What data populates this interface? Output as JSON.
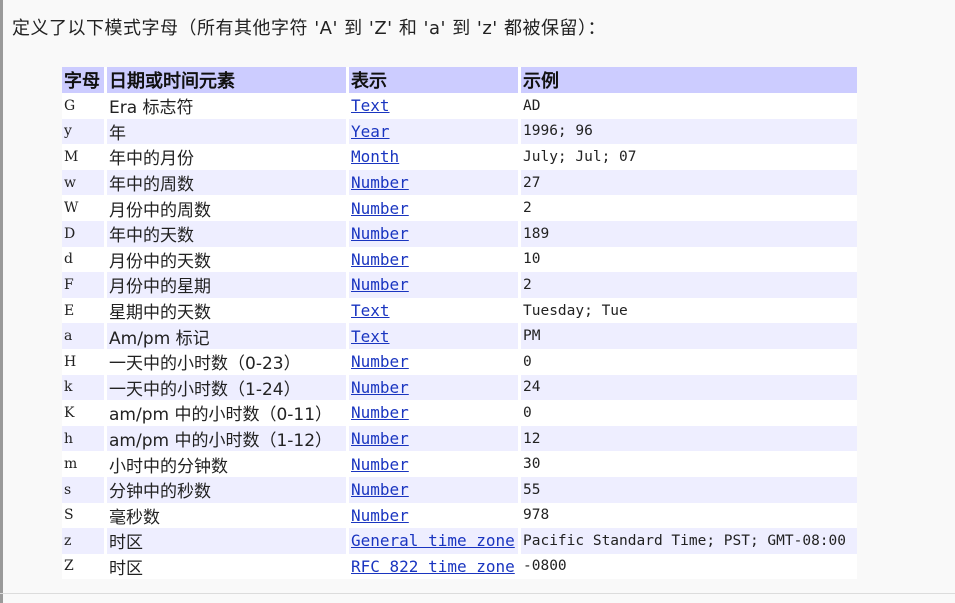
{
  "intro": "定义了以下模式字母（所有其他字符 'A' 到 'Z' 和 'a' 到 'z' 都被保留）：",
  "table": {
    "headers": [
      "字母",
      "日期或时间元素",
      "表示",
      "示例"
    ],
    "rows": [
      {
        "letter": "G",
        "element": "Era 标志符",
        "presentation": "Text",
        "example": "AD"
      },
      {
        "letter": "y",
        "element": "年",
        "presentation": "Year",
        "example": "1996; 96"
      },
      {
        "letter": "M",
        "element": "年中的月份",
        "presentation": "Month",
        "example": "July; Jul; 07"
      },
      {
        "letter": "w",
        "element": "年中的周数",
        "presentation": "Number",
        "example": "27"
      },
      {
        "letter": "W",
        "element": "月份中的周数",
        "presentation": "Number",
        "example": "2"
      },
      {
        "letter": "D",
        "element": "年中的天数",
        "presentation": "Number",
        "example": "189"
      },
      {
        "letter": "d",
        "element": "月份中的天数",
        "presentation": "Number",
        "example": "10"
      },
      {
        "letter": "F",
        "element": "月份中的星期",
        "presentation": "Number",
        "example": "2"
      },
      {
        "letter": "E",
        "element": "星期中的天数",
        "presentation": "Text",
        "example": "Tuesday; Tue"
      },
      {
        "letter": "a",
        "element": "Am/pm 标记",
        "presentation": "Text",
        "example": "PM"
      },
      {
        "letter": "H",
        "element": "一天中的小时数（0-23）",
        "presentation": "Number",
        "example": "0"
      },
      {
        "letter": "k",
        "element": "一天中的小时数（1-24）",
        "presentation": "Number",
        "example": "24"
      },
      {
        "letter": "K",
        "element": "am/pm 中的小时数（0-11）",
        "presentation": "Number",
        "example": "0"
      },
      {
        "letter": "h",
        "element": "am/pm 中的小时数（1-12）",
        "presentation": "Number",
        "example": "12"
      },
      {
        "letter": "m",
        "element": "小时中的分钟数",
        "presentation": "Number",
        "example": "30"
      },
      {
        "letter": "s",
        "element": "分钟中的秒数",
        "presentation": "Number",
        "example": "55"
      },
      {
        "letter": "S",
        "element": "毫秒数",
        "presentation": "Number",
        "example": "978"
      },
      {
        "letter": "z",
        "element": "时区",
        "presentation": "General time zone",
        "example": "Pacific Standard Time; PST; GMT-08:00"
      },
      {
        "letter": "Z",
        "element": "时区",
        "presentation": "RFC 822 time zone",
        "example": "-0800"
      }
    ]
  }
}
